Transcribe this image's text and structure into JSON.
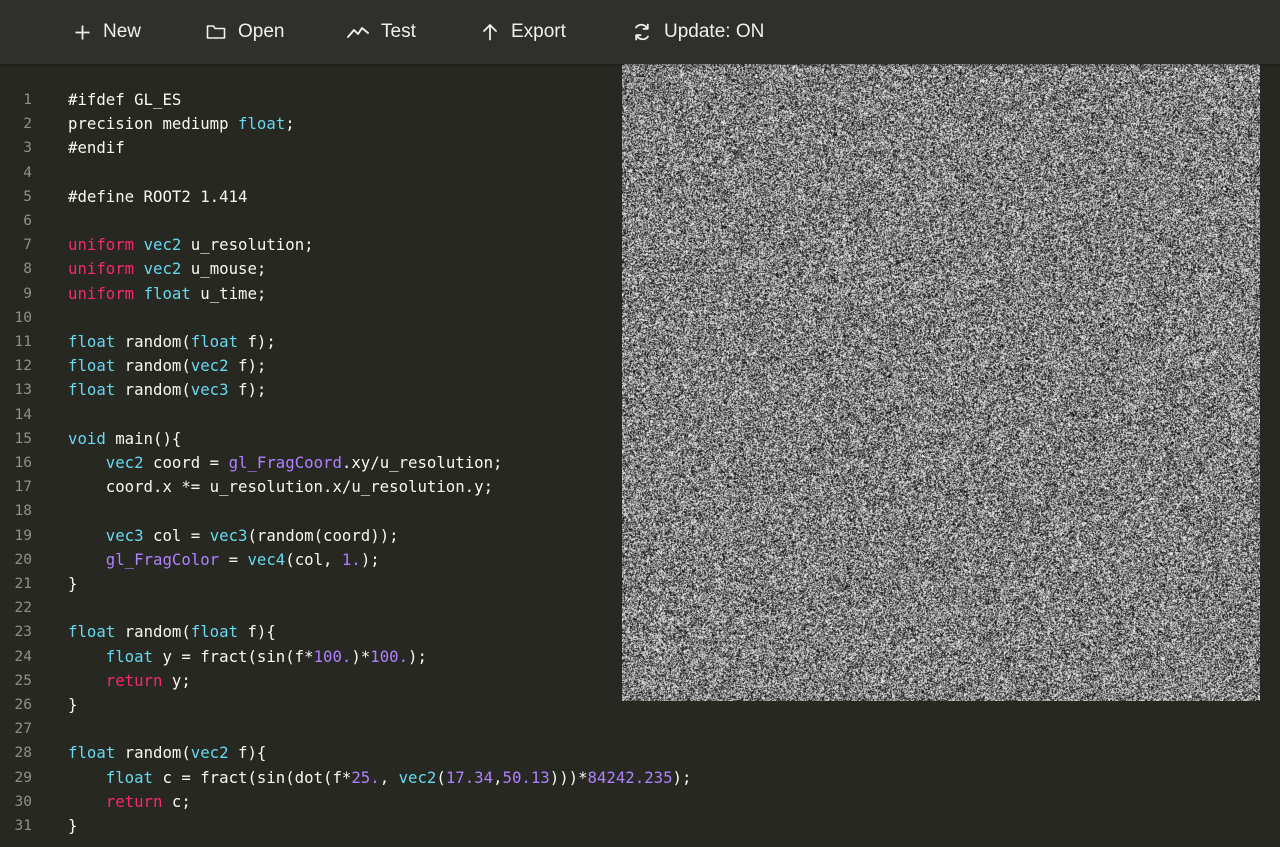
{
  "toolbar": {
    "buttons": [
      {
        "id": "new",
        "label": "New",
        "icon": "plus-icon"
      },
      {
        "id": "open",
        "label": "Open",
        "icon": "folder-icon"
      },
      {
        "id": "test",
        "label": "Test",
        "icon": "trend-line-icon"
      },
      {
        "id": "export",
        "label": "Export",
        "icon": "arrow-up-icon"
      },
      {
        "id": "update",
        "label": "Update: ON",
        "icon": "refresh-icon"
      }
    ]
  },
  "colors": {
    "background": "#272822",
    "toolbar": "#2f302b",
    "text": "#f8f8f2",
    "line_number": "#8f908a",
    "type": "#66d9ef",
    "qualifier": "#f92672",
    "builtin": "#ae81ff",
    "number": "#ae81ff"
  },
  "editor": {
    "lines": [
      [
        {
          "t": "#ifdef GL_ES",
          "c": "plain"
        }
      ],
      [
        {
          "t": "precision mediump ",
          "c": "plain"
        },
        {
          "t": "float",
          "c": "type"
        },
        {
          "t": ";",
          "c": "plain"
        }
      ],
      [
        {
          "t": "#endif",
          "c": "plain"
        }
      ],
      [],
      [
        {
          "t": "#define ROOT2 1.414",
          "c": "plain"
        }
      ],
      [],
      [
        {
          "t": "uniform",
          "c": "qual"
        },
        {
          "t": " ",
          "c": "plain"
        },
        {
          "t": "vec2",
          "c": "type"
        },
        {
          "t": " u_resolution;",
          "c": "plain"
        }
      ],
      [
        {
          "t": "uniform",
          "c": "qual"
        },
        {
          "t": " ",
          "c": "plain"
        },
        {
          "t": "vec2",
          "c": "type"
        },
        {
          "t": " u_mouse;",
          "c": "plain"
        }
      ],
      [
        {
          "t": "uniform",
          "c": "qual"
        },
        {
          "t": " ",
          "c": "plain"
        },
        {
          "t": "float",
          "c": "type"
        },
        {
          "t": " u_time;",
          "c": "plain"
        }
      ],
      [],
      [
        {
          "t": "float",
          "c": "type"
        },
        {
          "t": " random(",
          "c": "plain"
        },
        {
          "t": "float",
          "c": "type"
        },
        {
          "t": " f);",
          "c": "plain"
        }
      ],
      [
        {
          "t": "float",
          "c": "type"
        },
        {
          "t": " random(",
          "c": "plain"
        },
        {
          "t": "vec2",
          "c": "type"
        },
        {
          "t": " f);",
          "c": "plain"
        }
      ],
      [
        {
          "t": "float",
          "c": "type"
        },
        {
          "t": " random(",
          "c": "plain"
        },
        {
          "t": "vec3",
          "c": "type"
        },
        {
          "t": " f);",
          "c": "plain"
        }
      ],
      [],
      [
        {
          "t": "void",
          "c": "type"
        },
        {
          "t": " main(){",
          "c": "plain"
        }
      ],
      [
        {
          "t": "    ",
          "c": "plain"
        },
        {
          "t": "vec2",
          "c": "type"
        },
        {
          "t": " coord = ",
          "c": "plain"
        },
        {
          "t": "gl_FragCoord",
          "c": "builtin"
        },
        {
          "t": ".xy/u_resolution;",
          "c": "plain"
        }
      ],
      [
        {
          "t": "    coord.x *= u_resolution.x/u_resolution.y;",
          "c": "plain"
        }
      ],
      [],
      [
        {
          "t": "    ",
          "c": "plain"
        },
        {
          "t": "vec3",
          "c": "type"
        },
        {
          "t": " col = ",
          "c": "plain"
        },
        {
          "t": "vec3",
          "c": "type"
        },
        {
          "t": "(random(coord));",
          "c": "plain"
        }
      ],
      [
        {
          "t": "    ",
          "c": "plain"
        },
        {
          "t": "gl_FragColor",
          "c": "builtin"
        },
        {
          "t": " = ",
          "c": "plain"
        },
        {
          "t": "vec4",
          "c": "type"
        },
        {
          "t": "(col, ",
          "c": "plain"
        },
        {
          "t": "1.",
          "c": "num"
        },
        {
          "t": ");",
          "c": "plain"
        }
      ],
      [
        {
          "t": "}",
          "c": "plain"
        }
      ],
      [],
      [
        {
          "t": "float",
          "c": "type"
        },
        {
          "t": " random(",
          "c": "plain"
        },
        {
          "t": "float",
          "c": "type"
        },
        {
          "t": " f){",
          "c": "plain"
        }
      ],
      [
        {
          "t": "    ",
          "c": "plain"
        },
        {
          "t": "float",
          "c": "type"
        },
        {
          "t": " y = fract(sin(f*",
          "c": "plain"
        },
        {
          "t": "100.",
          "c": "num"
        },
        {
          "t": ")*",
          "c": "plain"
        },
        {
          "t": "100.",
          "c": "num"
        },
        {
          "t": ");",
          "c": "plain"
        }
      ],
      [
        {
          "t": "    ",
          "c": "plain"
        },
        {
          "t": "return",
          "c": "qual"
        },
        {
          "t": " y;",
          "c": "plain"
        }
      ],
      [
        {
          "t": "}",
          "c": "plain"
        }
      ],
      [],
      [
        {
          "t": "float",
          "c": "type"
        },
        {
          "t": " random(",
          "c": "plain"
        },
        {
          "t": "vec2",
          "c": "type"
        },
        {
          "t": " f){",
          "c": "plain"
        }
      ],
      [
        {
          "t": "    ",
          "c": "plain"
        },
        {
          "t": "float",
          "c": "type"
        },
        {
          "t": " c = fract(sin(dot(f*",
          "c": "plain"
        },
        {
          "t": "25.",
          "c": "num"
        },
        {
          "t": ", ",
          "c": "plain"
        },
        {
          "t": "vec2",
          "c": "type"
        },
        {
          "t": "(",
          "c": "plain"
        },
        {
          "t": "17.34",
          "c": "num"
        },
        {
          "t": ",",
          "c": "plain"
        },
        {
          "t": "50.13",
          "c": "num"
        },
        {
          "t": ")))*",
          "c": "plain"
        },
        {
          "t": "84242.235",
          "c": "num"
        },
        {
          "t": ");",
          "c": "plain"
        }
      ],
      [
        {
          "t": "    ",
          "c": "plain"
        },
        {
          "t": "return",
          "c": "qual"
        },
        {
          "t": " c;",
          "c": "plain"
        }
      ],
      [
        {
          "t": "}",
          "c": "plain"
        }
      ]
    ]
  }
}
